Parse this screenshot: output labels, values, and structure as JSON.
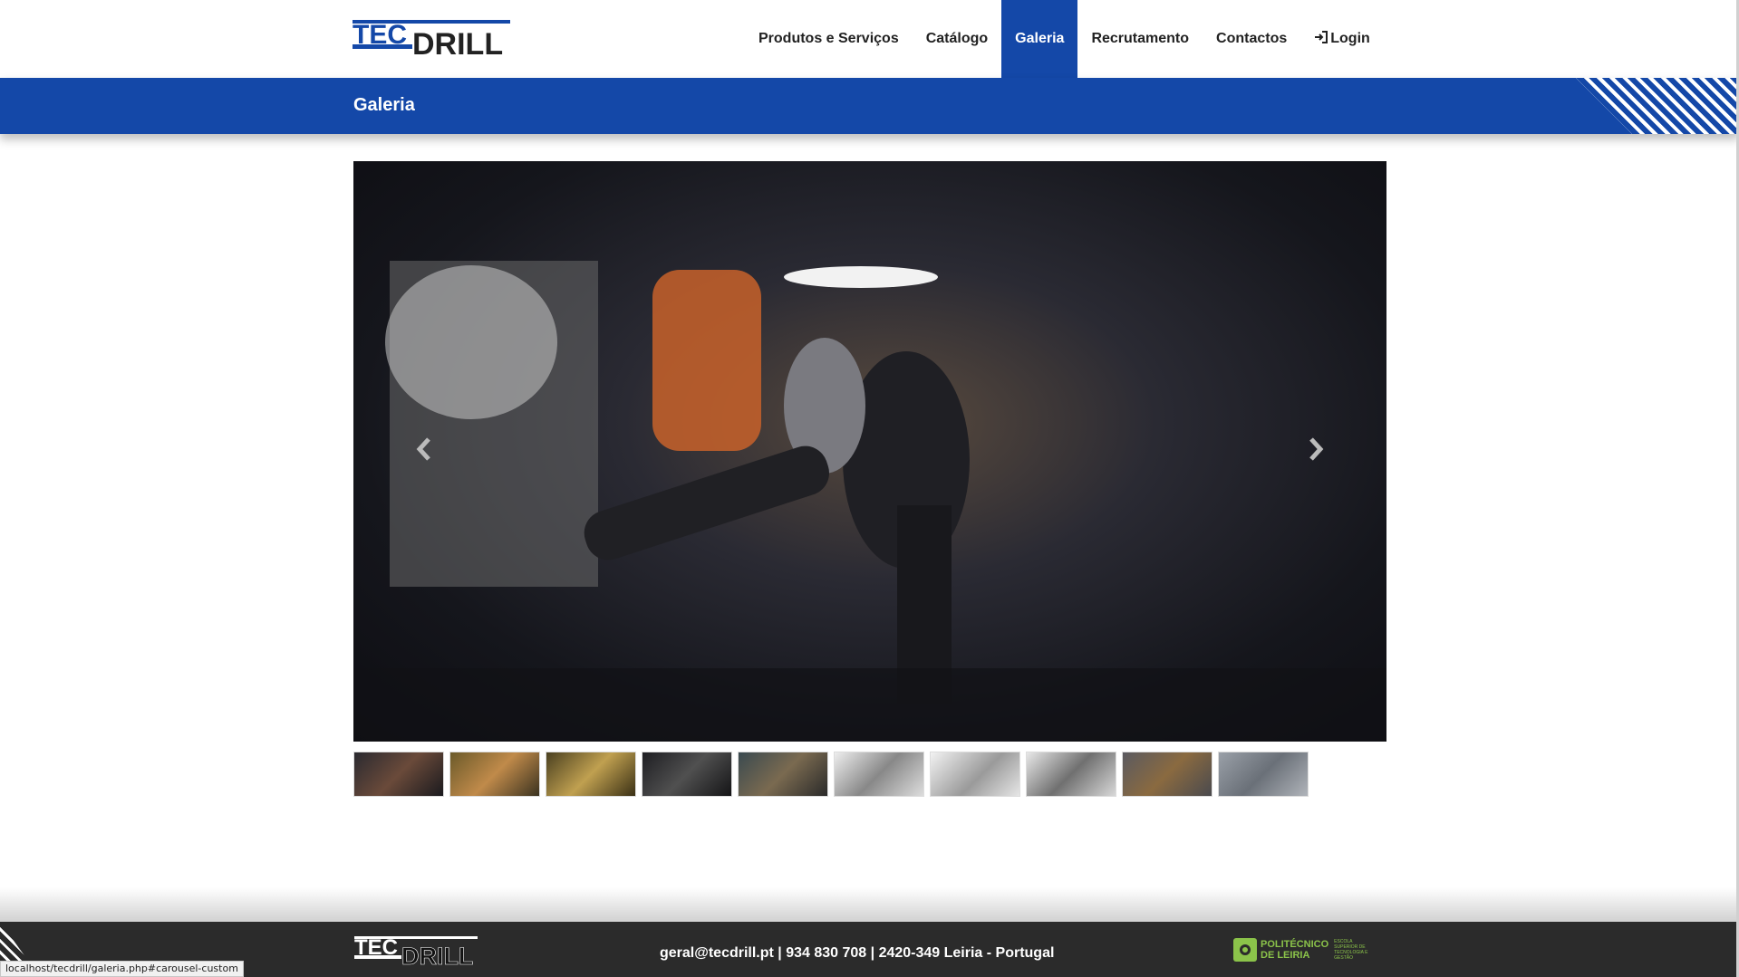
{
  "brand": {
    "logo_text_top": "TEC",
    "logo_text_bottom": "DRILL",
    "primary_color": "#1448a8",
    "dark_color": "#2b2b2b"
  },
  "nav": {
    "items": [
      {
        "label": "Produtos e Serviços",
        "active": false
      },
      {
        "label": "Catálogo",
        "active": false
      },
      {
        "label": "Galeria",
        "active": true
      },
      {
        "label": "Recrutamento",
        "active": false
      },
      {
        "label": "Contactos",
        "active": false
      }
    ],
    "login_label": "Login",
    "login_icon": "sign-in-icon"
  },
  "page": {
    "title": "Galeria"
  },
  "carousel": {
    "prev_icon": "chevron-left-icon",
    "next_icon": "chevron-right-icon",
    "thumbnail_count": 10
  },
  "footer": {
    "contact": "geral@tecdrill.pt | 934 830 708 | 2420-349 Leiria - Portugal",
    "partner_name_line1": "POLITÉCNICO",
    "partner_name_line2": "DE LEIRIA",
    "partner_sub": "ESCOLA SUPERIOR DE TECNOLOGIA E GESTÃO"
  },
  "statusbar": {
    "url": "localhost/tecdrill/galeria.php#carousel-custom"
  }
}
